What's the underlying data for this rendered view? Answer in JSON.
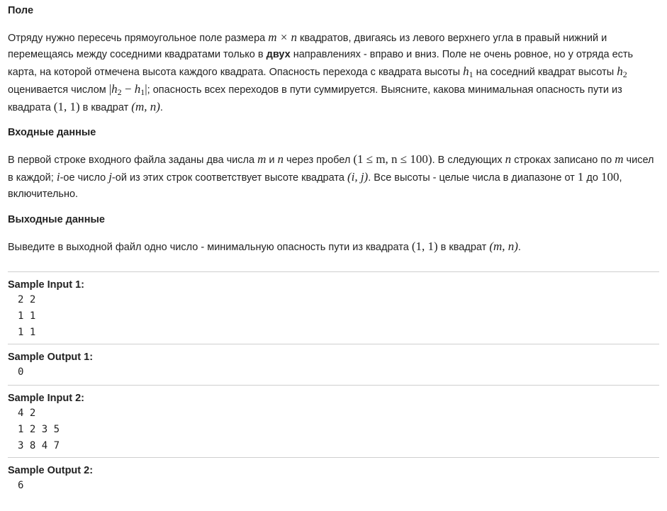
{
  "sections": {
    "field": {
      "title": "Поле",
      "p1_a": "Отряду нужно пересечь прямоугольное поле размера ",
      "p1_math1": "m × n",
      "p1_b": " квадратов, двигаясь из левого верхнего угла в правый нижний и перемещаясь между соседними квадратами только в ",
      "p1_bold": "двух",
      "p1_c": " направлениях - вправо и вниз. Поле не очень ровное, но у отряда есть карта, на которой отмечена высота каждого квадрата. Опасность перехода с квадрата высоты ",
      "p1_h": "h",
      "p1_sub1": "1",
      "p1_d": " на соседний квадрат высоты ",
      "p1_sub2": "2",
      "p1_e": " оценивается числом ",
      "p1_abs_open": "|",
      "p1_minus": " − ",
      "p1_abs_close": "|",
      "p1_f": "; опасность всех переходов в пути суммируется. Выясните, какова минимальная опасность пути из квадрата ",
      "p1_start": "(1, 1)",
      "p1_g": " в квадрат ",
      "p1_end": "(m, n)",
      "p1_h_end": "."
    },
    "input": {
      "title": "Входные данные",
      "p_a": "В первой строке входного файла заданы два числа ",
      "p_m": "m",
      "p_and": " и ",
      "p_n": "n",
      "p_b": " через пробел ",
      "p_constraint": "(1 ≤ m, n ≤ 100)",
      "p_c": ". В следующих ",
      "p_d": " строках записано по ",
      "p_e": " чисел в каждой; ",
      "p_i": "i",
      "p_f": "-ое число ",
      "p_j": "j",
      "p_g": "-ой из этих строк соответствует высоте квадрата ",
      "p_ij": "(i, j)",
      "p_h": ". Все высоты - целые числа в диапазоне от ",
      "p_one": "1",
      "p_to": " до ",
      "p_hundred": "100",
      "p_end": ", включительно."
    },
    "output": {
      "title": "Выходные данные",
      "p_a": "Выведите в выходной файл одно число - минимальную опасность пути из квадрата ",
      "p_start": "(1, 1)",
      "p_b": " в квадрат ",
      "p_end": "(m, n)",
      "p_c": "."
    }
  },
  "samples": [
    {
      "title": "Sample Input 1:",
      "lines": [
        "2 2",
        "1 1",
        "1 1"
      ]
    },
    {
      "title": "Sample Output 1:",
      "lines": [
        "0"
      ]
    },
    {
      "title": "Sample Input 2:",
      "lines": [
        "4 2",
        "1 2 3 5",
        "3 8 4 7"
      ]
    },
    {
      "title": "Sample Output 2:",
      "lines": [
        "6"
      ]
    }
  ]
}
